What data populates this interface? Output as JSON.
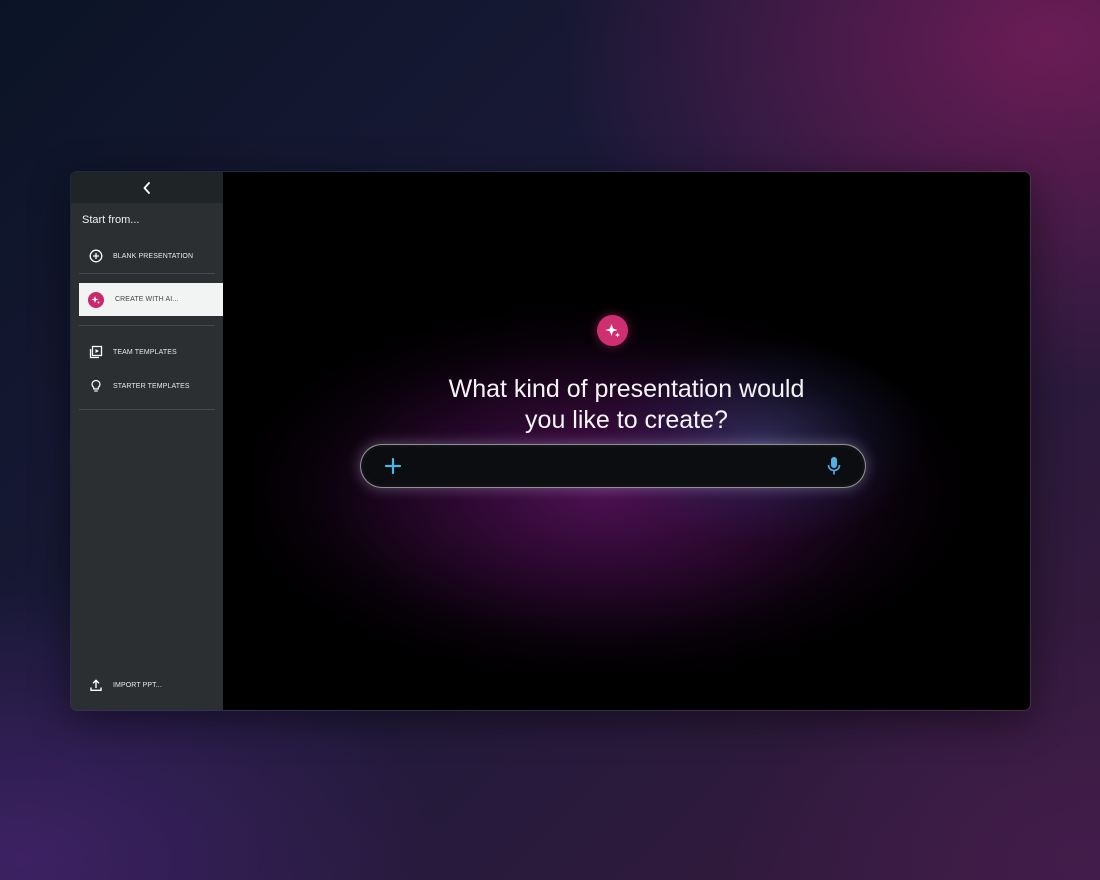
{
  "sidebar": {
    "collapse_icon": "chevron-left-icon",
    "heading": "Start from...",
    "items": [
      {
        "label": "BLANK PRESENTATION",
        "icon": "plus-circle-icon"
      },
      {
        "label": "CREATE WITH AI...",
        "icon": "sparkle-icon",
        "selected": true
      },
      {
        "label": "TEAM TEMPLATES",
        "icon": "template-library-icon"
      },
      {
        "label": "STARTER TEMPLATES",
        "icon": "lightbulb-icon"
      }
    ],
    "footer_item": {
      "label": "IMPORT PPT...",
      "icon": "upload-icon"
    }
  },
  "main": {
    "badge_icon": "sparkle-icon",
    "heading_line1": "What kind of presentation would",
    "heading_line2": "you like to create?",
    "prompt": {
      "value": "",
      "placeholder": "",
      "add_icon": "plus-icon",
      "mic_icon": "microphone-icon"
    }
  },
  "colors": {
    "accent": "#cf2f70",
    "icon_blue": "#4fb3e8",
    "sidebar_bg": "#2b2f31",
    "selected_bg": "#f2f3f3"
  }
}
